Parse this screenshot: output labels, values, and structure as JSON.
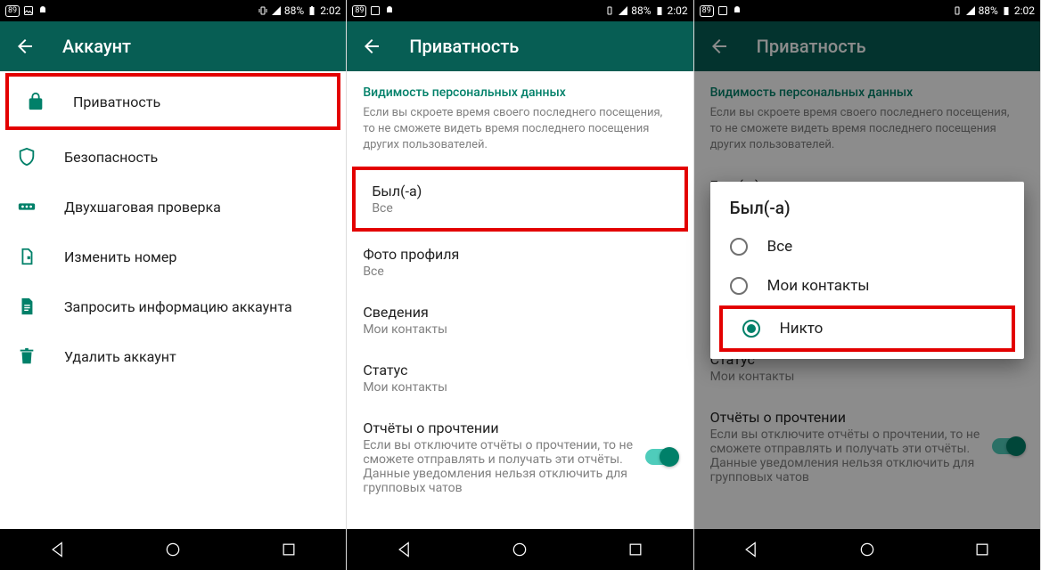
{
  "status": {
    "badge": "89",
    "battery": "88%",
    "time": "2:02"
  },
  "screen1": {
    "title": "Аккаунт",
    "items": [
      {
        "label": "Приватность"
      },
      {
        "label": "Безопасность"
      },
      {
        "label": "Двухшаговая проверка"
      },
      {
        "label": "Изменить номер"
      },
      {
        "label": "Запросить информацию аккаунта"
      },
      {
        "label": "Удалить аккаунт"
      }
    ]
  },
  "screen2": {
    "title": "Приватность",
    "section_header": "Видимость персональных данных",
    "section_desc": "Если вы скроете время своего последнего посещения, то не сможете видеть время последнего посещения других пользователей.",
    "prefs": {
      "last_seen": {
        "title": "Был(-а)",
        "value": "Все"
      },
      "photo": {
        "title": "Фото профиля",
        "value": "Все"
      },
      "about": {
        "title": "Сведения",
        "value": "Мои контакты"
      },
      "status": {
        "title": "Статус",
        "value": "Мои контакты"
      },
      "read_receipts": {
        "title": "Отчёты о прочтении",
        "desc": "Если вы отключите отчёты о прочтении, то не сможете отправлять и получать эти отчёты. Данные уведомления нельзя отключить для групповых чатов"
      }
    }
  },
  "screen3": {
    "title": "Приватность",
    "dialog": {
      "title": "Был(-а)",
      "options": [
        {
          "label": "Все"
        },
        {
          "label": "Мои контакты"
        },
        {
          "label": "Никто"
        }
      ]
    }
  }
}
